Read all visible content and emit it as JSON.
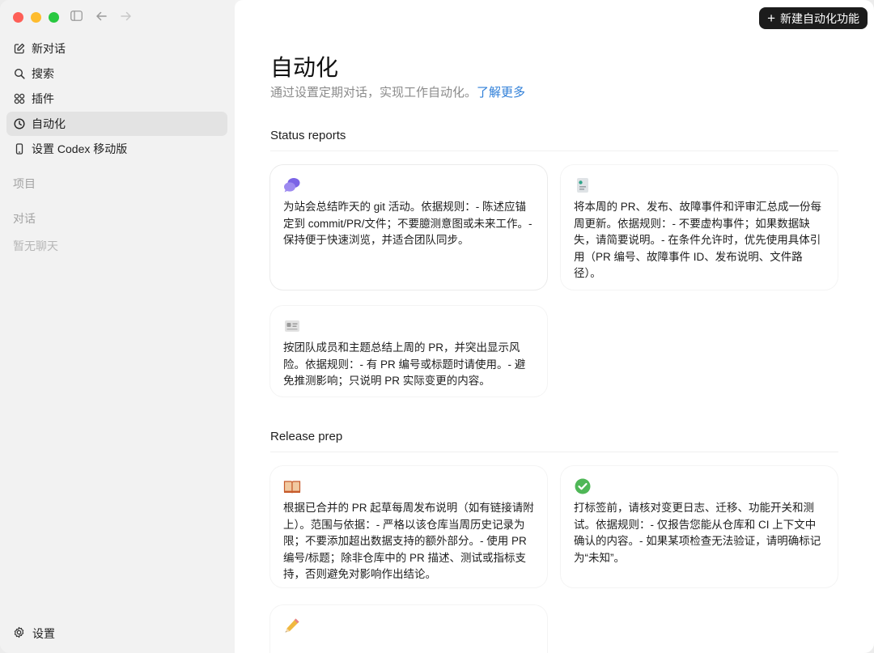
{
  "sidebar": {
    "nav": [
      {
        "label": "新对话",
        "icon": "edit-icon"
      },
      {
        "label": "搜索",
        "icon": "search-icon"
      },
      {
        "label": "插件",
        "icon": "plugins-icon"
      },
      {
        "label": "自动化",
        "icon": "clock-icon"
      },
      {
        "label": "设置 Codex 移动版",
        "icon": "phone-icon"
      }
    ],
    "projects_label": "项目",
    "chats_label": "对话",
    "no_chats": "暂无聊天",
    "settings_label": "设置"
  },
  "toolbar": {
    "new_automation": "新建自动化功能"
  },
  "page": {
    "title": "自动化",
    "subtitle": "通过设置定期对话，实现工作自动化。",
    "learn_more": "了解更多"
  },
  "sections": [
    {
      "title": "Status reports",
      "cards": [
        {
          "icon": "chat-bubbles-icon",
          "text": "为站会总结昨天的 git 活动。依据规则：- 陈述应锚定到 commit/PR/文件；不要臆测意图或未来工作。- 保持便于快速浏览，并适合团队同步。"
        },
        {
          "icon": "report-icon",
          "text": "将本周的 PR、发布、故障事件和评审汇总成一份每周更新。依据规则：- 不要虚构事件；如果数据缺失，请简要说明。- 在条件允许时，优先使用具体引用（PR 编号、故障事件 ID、发布说明、文件路径）。"
        },
        {
          "icon": "id-card-icon",
          "text": "按团队成员和主题总结上周的 PR，并突出显示风险。依据规则：- 有 PR 编号或标题时请使用。- 避免推测影响；只说明 PR 实际变更的内容。"
        }
      ]
    },
    {
      "title": "Release prep",
      "cards": [
        {
          "icon": "open-book-icon",
          "text": "根据已合并的 PR 起草每周发布说明（如有链接请附上）。范围与依据：- 严格以该仓库当周历史记录为限；不要添加超出数据支持的额外部分。- 使用 PR 编号/标题；除非仓库中的 PR 描述、测试或指标支持，否则避免对影响作出结论。"
        },
        {
          "icon": "check-circle-icon",
          "text": "打标签前，请核对变更日志、迁移、功能开关和测试。依据规则：- 仅报告您能从仓库和 CI 上下文中确认的内容。- 如果某项检查无法验证，请明确标记为“未知”。"
        },
        {
          "icon": "pencil-icon",
          "text": ""
        }
      ]
    }
  ],
  "colors": {
    "accent_link": "#2f7fd8",
    "button_bg": "#1c1c1c",
    "traffic_red": "#fe5f57",
    "traffic_yellow": "#febc2e",
    "traffic_green": "#28c840"
  }
}
